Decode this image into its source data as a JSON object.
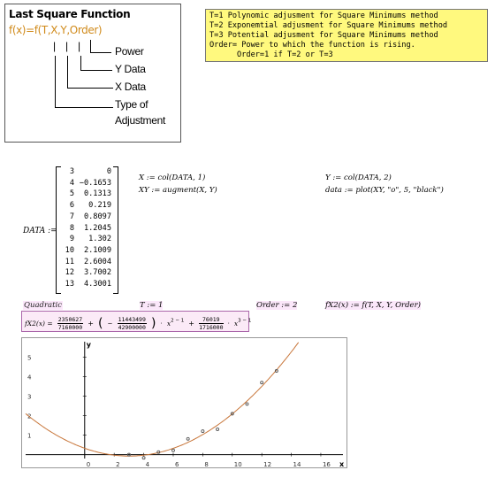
{
  "legend": {
    "title": "Last Square Function",
    "formula": "f(x)=f(T,X,Y,Order)",
    "bar1": "|",
    "bar2": "|",
    "bar3": "|",
    "labels": [
      "Power",
      "Y Data",
      "X Data",
      "Type of",
      "Adjustment"
    ]
  },
  "notes": [
    "T=1 Polynomic adjusment for Square Minimums method",
    "T=2 Exponemtial adjusment for Square Minimums method",
    "T=3 Potential adjusment for Square Minimums method",
    "Order= Power to which the function is rising.",
    "      Order=1 if T=2 or T=3"
  ],
  "data_label": "DATA :=",
  "data_matrix": [
    [
      "3",
      "0"
    ],
    [
      "4",
      "−0.1653"
    ],
    [
      "5",
      "0.1313"
    ],
    [
      "6",
      "0.219"
    ],
    [
      "7",
      "0.8097"
    ],
    [
      "8",
      "1.2045"
    ],
    [
      "9",
      "1.302"
    ],
    [
      "10",
      "2.1009"
    ],
    [
      "11",
      "2.6004"
    ],
    [
      "12",
      "3.7002"
    ],
    [
      "13",
      "4.3001"
    ]
  ],
  "exprs": {
    "x_assign": "X := col(DATA, 1)",
    "xy_assign": "XY := augment(X, Y)",
    "y_assign": "Y := col(DATA, 2)",
    "plot_assign": "data := plot(XY, \"o\", 5, \"black\")"
  },
  "quadratic_label": "Quadratic",
  "t_assign": "T := 1",
  "order_assign": "Order := 2",
  "fx2_def": "fX2(x) := f(T, X, Y, Order)",
  "fx2_result": {
    "lhs": "fX2(x) =",
    "c0_num": "2350627",
    "c0_den": "7160000",
    "c1_num": "11443499",
    "c1_den": "42900000",
    "c2_num": "76019",
    "c2_den": "1716000",
    "x_term1": "x",
    "exp1": "2 − 1",
    "x_term2": "x",
    "exp2": "3 − 1"
  },
  "chart_data": {
    "type": "scatter",
    "x_ticks": [
      "0",
      "2",
      "4",
      "6",
      "8",
      "10",
      "12",
      "14",
      "16"
    ],
    "y_ticks": [
      "1",
      "2",
      "3",
      "4",
      "5"
    ],
    "x_axis_label": "x",
    "y_axis_label": "y",
    "xlim": [
      -4,
      17.5
    ],
    "ylim": [
      -0.2,
      5.8
    ],
    "points": {
      "x": [
        3,
        4,
        5,
        6,
        7,
        8,
        9,
        10,
        11,
        12,
        13
      ],
      "y": [
        0,
        -0.1653,
        0.1313,
        0.219,
        0.8097,
        1.2045,
        1.302,
        2.1009,
        2.6004,
        3.7002,
        4.3001
      ]
    },
    "curve": {
      "c0": 0.3283,
      "c1": -0.26675,
      "c2": 0.0443
    },
    "colors": {
      "curve": "#c8763a",
      "points": "#555555"
    }
  }
}
